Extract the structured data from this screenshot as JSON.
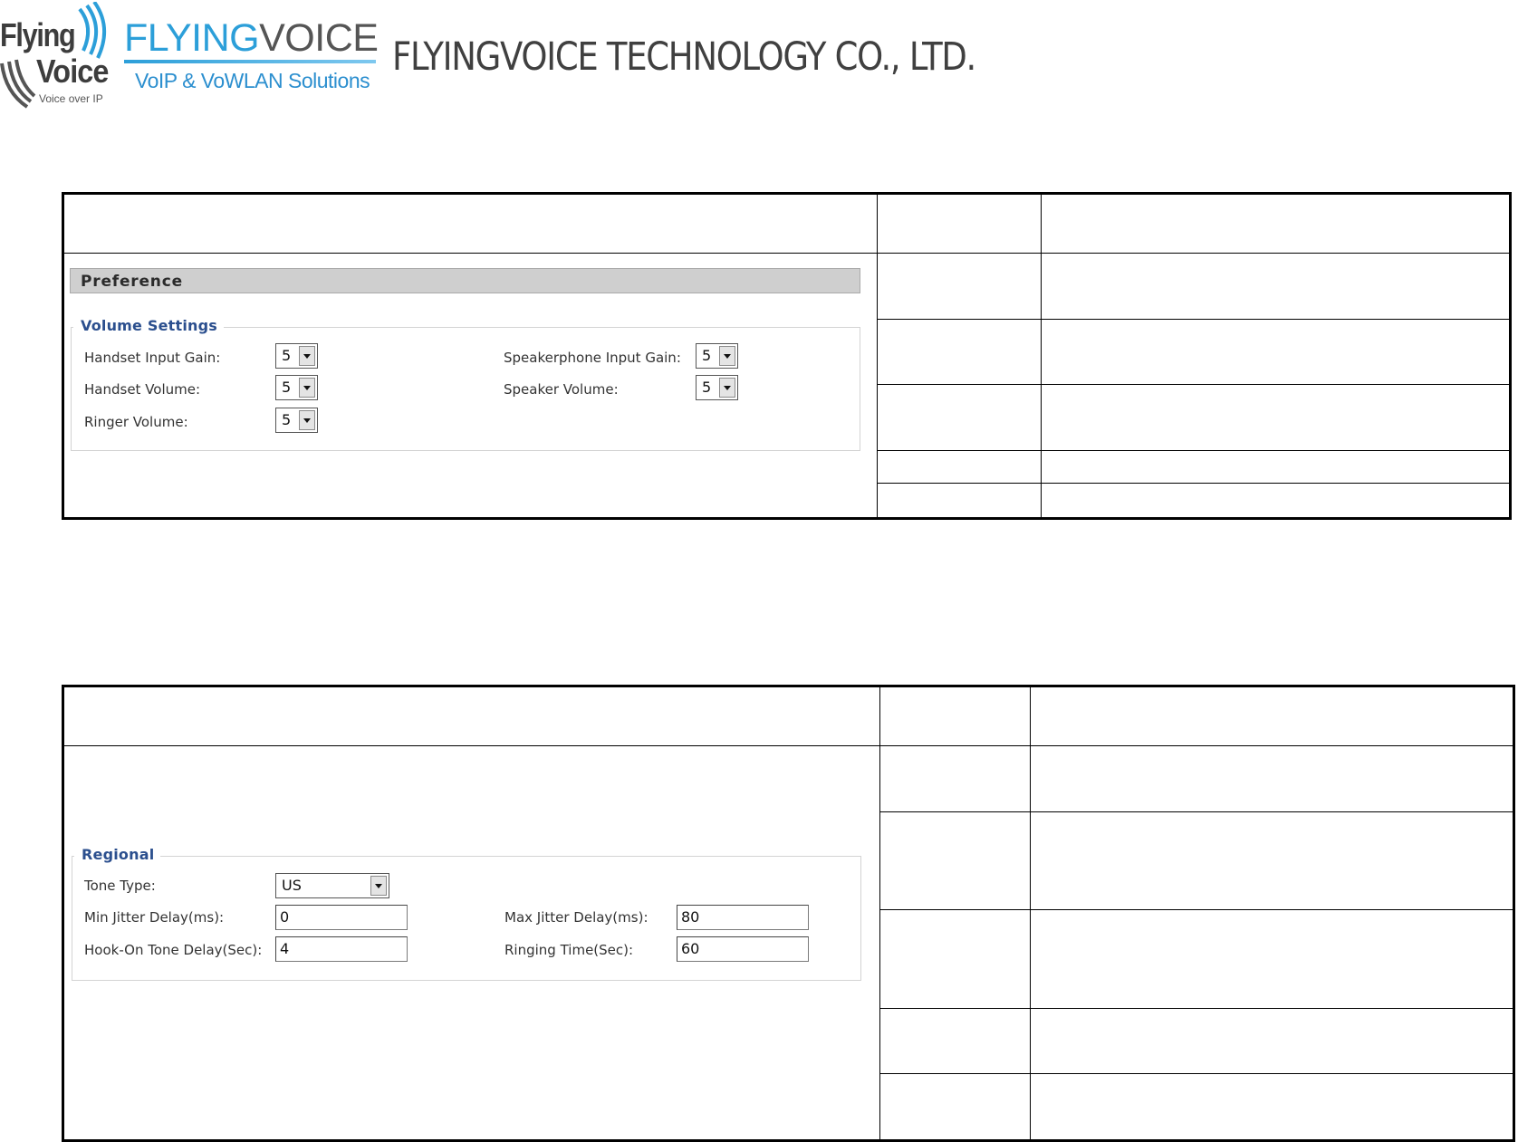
{
  "header": {
    "logo_left": {
      "line1": "Flying",
      "line2": "Voice",
      "sub": "Voice over IP"
    },
    "logo_right": {
      "word_a": "FLYING",
      "word_b": "VOICE",
      "tagline": "VoIP & VoWLAN Solutions"
    },
    "company_name": "FLYINGVOICE TECHNOLOGY CO., LTD."
  },
  "colors": {
    "brand_blue": "#2c9fd9",
    "legend_blue": "#2b4f8e",
    "panel_gray": "#cfcfcf"
  },
  "preference_form": {
    "panel_title": "Preference",
    "group_title": "Volume Settings",
    "fields": {
      "handset_input_gain": {
        "label": "Handset Input Gain:",
        "value": "5"
      },
      "handset_volume": {
        "label": "Handset Volume:",
        "value": "5"
      },
      "ringer_volume": {
        "label": "Ringer Volume:",
        "value": "5"
      },
      "speakerphone_input_gain": {
        "label": "Speakerphone Input Gain:",
        "value": "5"
      },
      "speaker_volume": {
        "label": "Speaker Volume:",
        "value": "5"
      }
    }
  },
  "regional_form": {
    "group_title": "Regional",
    "fields": {
      "tone_type": {
        "label": "Tone Type:",
        "value": "US"
      },
      "min_jitter": {
        "label": "Min Jitter Delay(ms):",
        "value": "0"
      },
      "hook_on_tone_delay": {
        "label": "Hook-On Tone Delay(Sec):",
        "value": "4"
      },
      "max_jitter": {
        "label": "Max Jitter Delay(ms):",
        "value": "80"
      },
      "ringing_time": {
        "label": "Ringing Time(Sec):",
        "value": "60"
      }
    }
  }
}
